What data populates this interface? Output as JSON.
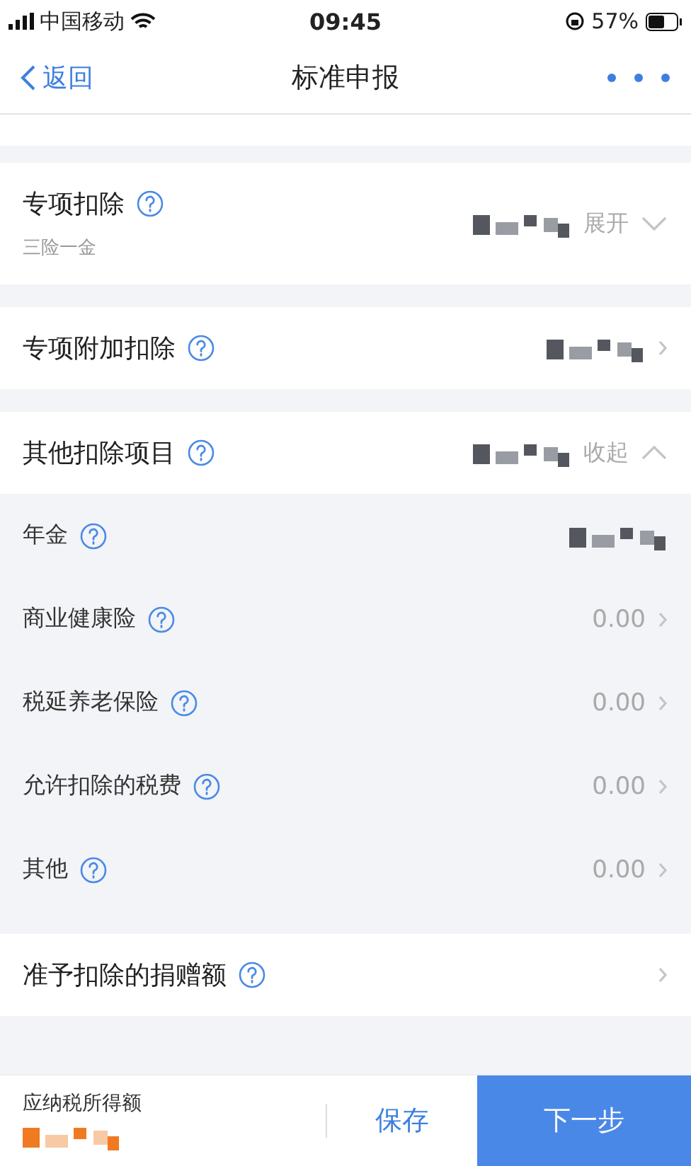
{
  "status_bar": {
    "carrier": "中国移动",
    "time": "09:45",
    "battery": "57%"
  },
  "nav": {
    "back": "返回",
    "title": "标准申报"
  },
  "sections": [
    {
      "kind": "toggle",
      "title": "专项扣除",
      "subtitle": "三险一金",
      "masked": true,
      "toggle": "展开",
      "expanded": false
    },
    {
      "kind": "link",
      "title": "专项附加扣除",
      "masked": true
    },
    {
      "kind": "toggle",
      "title": "其他扣除项目",
      "masked": true,
      "toggle": "收起",
      "expanded": true,
      "children": [
        {
          "title": "年金",
          "masked": true
        },
        {
          "title": "商业健康险",
          "value": "0.00"
        },
        {
          "title": "税延养老保险",
          "value": "0.00"
        },
        {
          "title": "允许扣除的税费",
          "value": "0.00"
        },
        {
          "title": "其他",
          "value": "0.00"
        }
      ]
    },
    {
      "kind": "link",
      "title": "准予扣除的捐赠额"
    }
  ],
  "footer": {
    "label": "应纳税所得额",
    "value_masked": true,
    "save": "保存",
    "next": "下一步"
  }
}
